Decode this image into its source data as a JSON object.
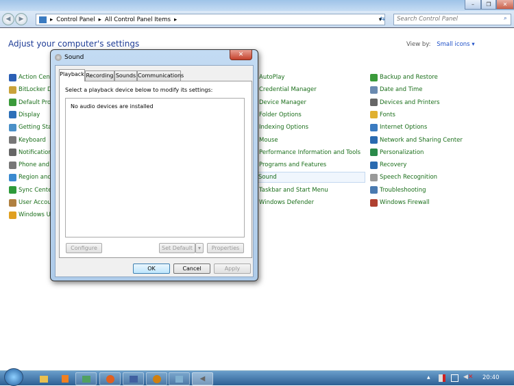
{
  "window": {
    "controls": {
      "minimize": "–",
      "maximize": "❐",
      "close": "✕"
    }
  },
  "nav": {
    "breadcrumb": [
      "Control Panel",
      "All Control Panel Items"
    ],
    "search_placeholder": "Search Control Panel"
  },
  "header": {
    "title": "Adjust your computer's settings",
    "view_by_label": "View by:",
    "view_by_value": "Small icons"
  },
  "columns": [
    [
      {
        "label": "Action Cent",
        "icon": "flag",
        "color": "#2b5fb5"
      },
      {
        "label": "BitLocker Dr",
        "icon": "bitlocker",
        "color": "#c9a23a"
      },
      {
        "label": "Default Prog",
        "icon": "default-programs",
        "color": "#3a9a3a"
      },
      {
        "label": "Display",
        "icon": "display",
        "color": "#2c6fb8"
      },
      {
        "label": "Getting Star",
        "icon": "getting-started",
        "color": "#4a90c8"
      },
      {
        "label": "Keyboard",
        "icon": "keyboard",
        "color": "#777777"
      },
      {
        "label": "Notification",
        "icon": "notification",
        "color": "#666666"
      },
      {
        "label": "Phone and M",
        "icon": "phone",
        "color": "#777777"
      },
      {
        "label": "Region and",
        "icon": "globe",
        "color": "#3a8ad0"
      },
      {
        "label": "Sync Center",
        "icon": "sync",
        "color": "#2e9a3a"
      },
      {
        "label": "User Accou",
        "icon": "users",
        "color": "#b08040"
      },
      {
        "label": "Windows Up",
        "icon": "windows-update",
        "color": "#e0a020"
      }
    ],
    [
      {
        "label": "AutoPlay"
      },
      {
        "label": "Credential Manager"
      },
      {
        "label": "Device Manager"
      },
      {
        "label": "Folder Options"
      },
      {
        "label": "Indexing Options"
      },
      {
        "label": "Mouse"
      },
      {
        "label": "Performance Information and Tools"
      },
      {
        "label": "Programs and Features"
      },
      {
        "label": "Sound",
        "selected": true
      },
      {
        "label": "Taskbar and Start Menu"
      },
      {
        "label": "Windows Defender"
      }
    ],
    [
      {
        "label": "Backup and Restore",
        "icon": "backup",
        "color": "#3a9a3a"
      },
      {
        "label": "Date and Time",
        "icon": "clock",
        "color": "#6a8ab0"
      },
      {
        "label": "Devices and Printers",
        "icon": "printer",
        "color": "#666666"
      },
      {
        "label": "Fonts",
        "icon": "fonts",
        "color": "#e0b030"
      },
      {
        "label": "Internet Options",
        "icon": "internet",
        "color": "#3a7ac0"
      },
      {
        "label": "Network and Sharing Center",
        "icon": "network",
        "color": "#2a6ab0"
      },
      {
        "label": "Personalization",
        "icon": "personalization",
        "color": "#2a8a4a"
      },
      {
        "label": "Recovery",
        "icon": "recovery",
        "color": "#2a6ab0"
      },
      {
        "label": "Speech Recognition",
        "icon": "microphone",
        "color": "#999999"
      },
      {
        "label": "Troubleshooting",
        "icon": "troubleshoot",
        "color": "#4a7ab0"
      },
      {
        "label": "Windows Firewall",
        "icon": "firewall",
        "color": "#b04030"
      }
    ]
  ],
  "dialog": {
    "title": "Sound",
    "close": "✕",
    "tabs": [
      "Playback",
      "Recording",
      "Sounds",
      "Communications"
    ],
    "instruction": "Select a playback device below to modify its settings:",
    "empty_message": "No audio devices are installed",
    "configure": "Configure",
    "set_default": "Set Default",
    "properties": "Properties",
    "ok": "OK",
    "cancel": "Cancel",
    "apply": "Apply"
  },
  "taskbar": {
    "clock": "20:40",
    "tray_arrow": "▲"
  }
}
